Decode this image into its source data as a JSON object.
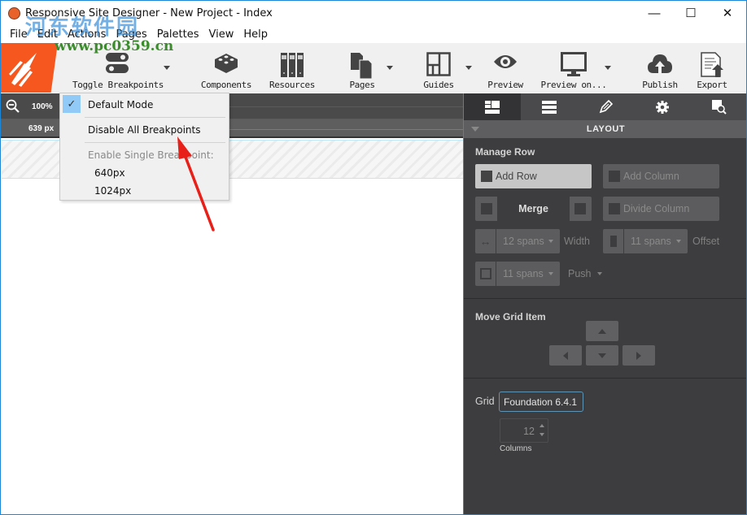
{
  "window": {
    "title": "Responsive Site Designer - New Project - Index",
    "controls": {
      "minimize": "—",
      "maximize": "☐",
      "close": "✕"
    }
  },
  "watermark": {
    "text": "河东软件园",
    "url_text": "www.pc0359.cn"
  },
  "menubar": [
    "File",
    "Edit",
    "Actions",
    "Pages",
    "Palettes",
    "View",
    "Help"
  ],
  "toolbar": {
    "items": [
      {
        "label": "Toggle Breakpoints",
        "icon": "toggle-icon",
        "has_dropdown": true
      },
      {
        "label": "Components",
        "icon": "components-icon",
        "has_dropdown": false
      },
      {
        "label": "Resources",
        "icon": "resources-icon",
        "has_dropdown": false
      },
      {
        "label": "Pages",
        "icon": "pages-icon",
        "has_dropdown": true
      },
      {
        "label": "Guides",
        "icon": "guides-icon",
        "has_dropdown": true
      },
      {
        "label": "Preview",
        "icon": "eye-icon",
        "has_dropdown": false
      },
      {
        "label": "Preview on...",
        "icon": "monitor-icon",
        "has_dropdown": true
      },
      {
        "label": "Publish",
        "icon": "cloud-upload-icon",
        "has_dropdown": false
      },
      {
        "label": "Export",
        "icon": "export-icon",
        "has_dropdown": false
      }
    ]
  },
  "canvas": {
    "zoom": "100%",
    "width": "639 px"
  },
  "breakpoints_menu": {
    "items": [
      {
        "label": "Default Mode",
        "checked": true
      },
      {
        "label": "Disable All Breakpoints",
        "checked": false
      }
    ],
    "section_label": "Enable Single Breakpoint:",
    "breakpoints": [
      "640px",
      "1024px"
    ]
  },
  "panel": {
    "tabs": [
      "layout",
      "rows",
      "style",
      "settings",
      "inspect"
    ],
    "active_tab": 0,
    "header": "LAYOUT",
    "manage_row": {
      "title": "Manage Row",
      "add_row": "Add Row",
      "add_column": "Add Column",
      "merge": "Merge",
      "divide_column": "Divide Column",
      "width_value": "12 spans",
      "width_label": "Width",
      "offset_value": "11 spans",
      "offset_label": "Offset",
      "push_value": "11 spans",
      "push_label": "Push"
    },
    "move_grid_item": {
      "title": "Move Grid Item"
    },
    "grid": {
      "label": "Grid",
      "framework": "Foundation 6.4.1",
      "columns_value": "12",
      "columns_label": "Columns"
    }
  }
}
